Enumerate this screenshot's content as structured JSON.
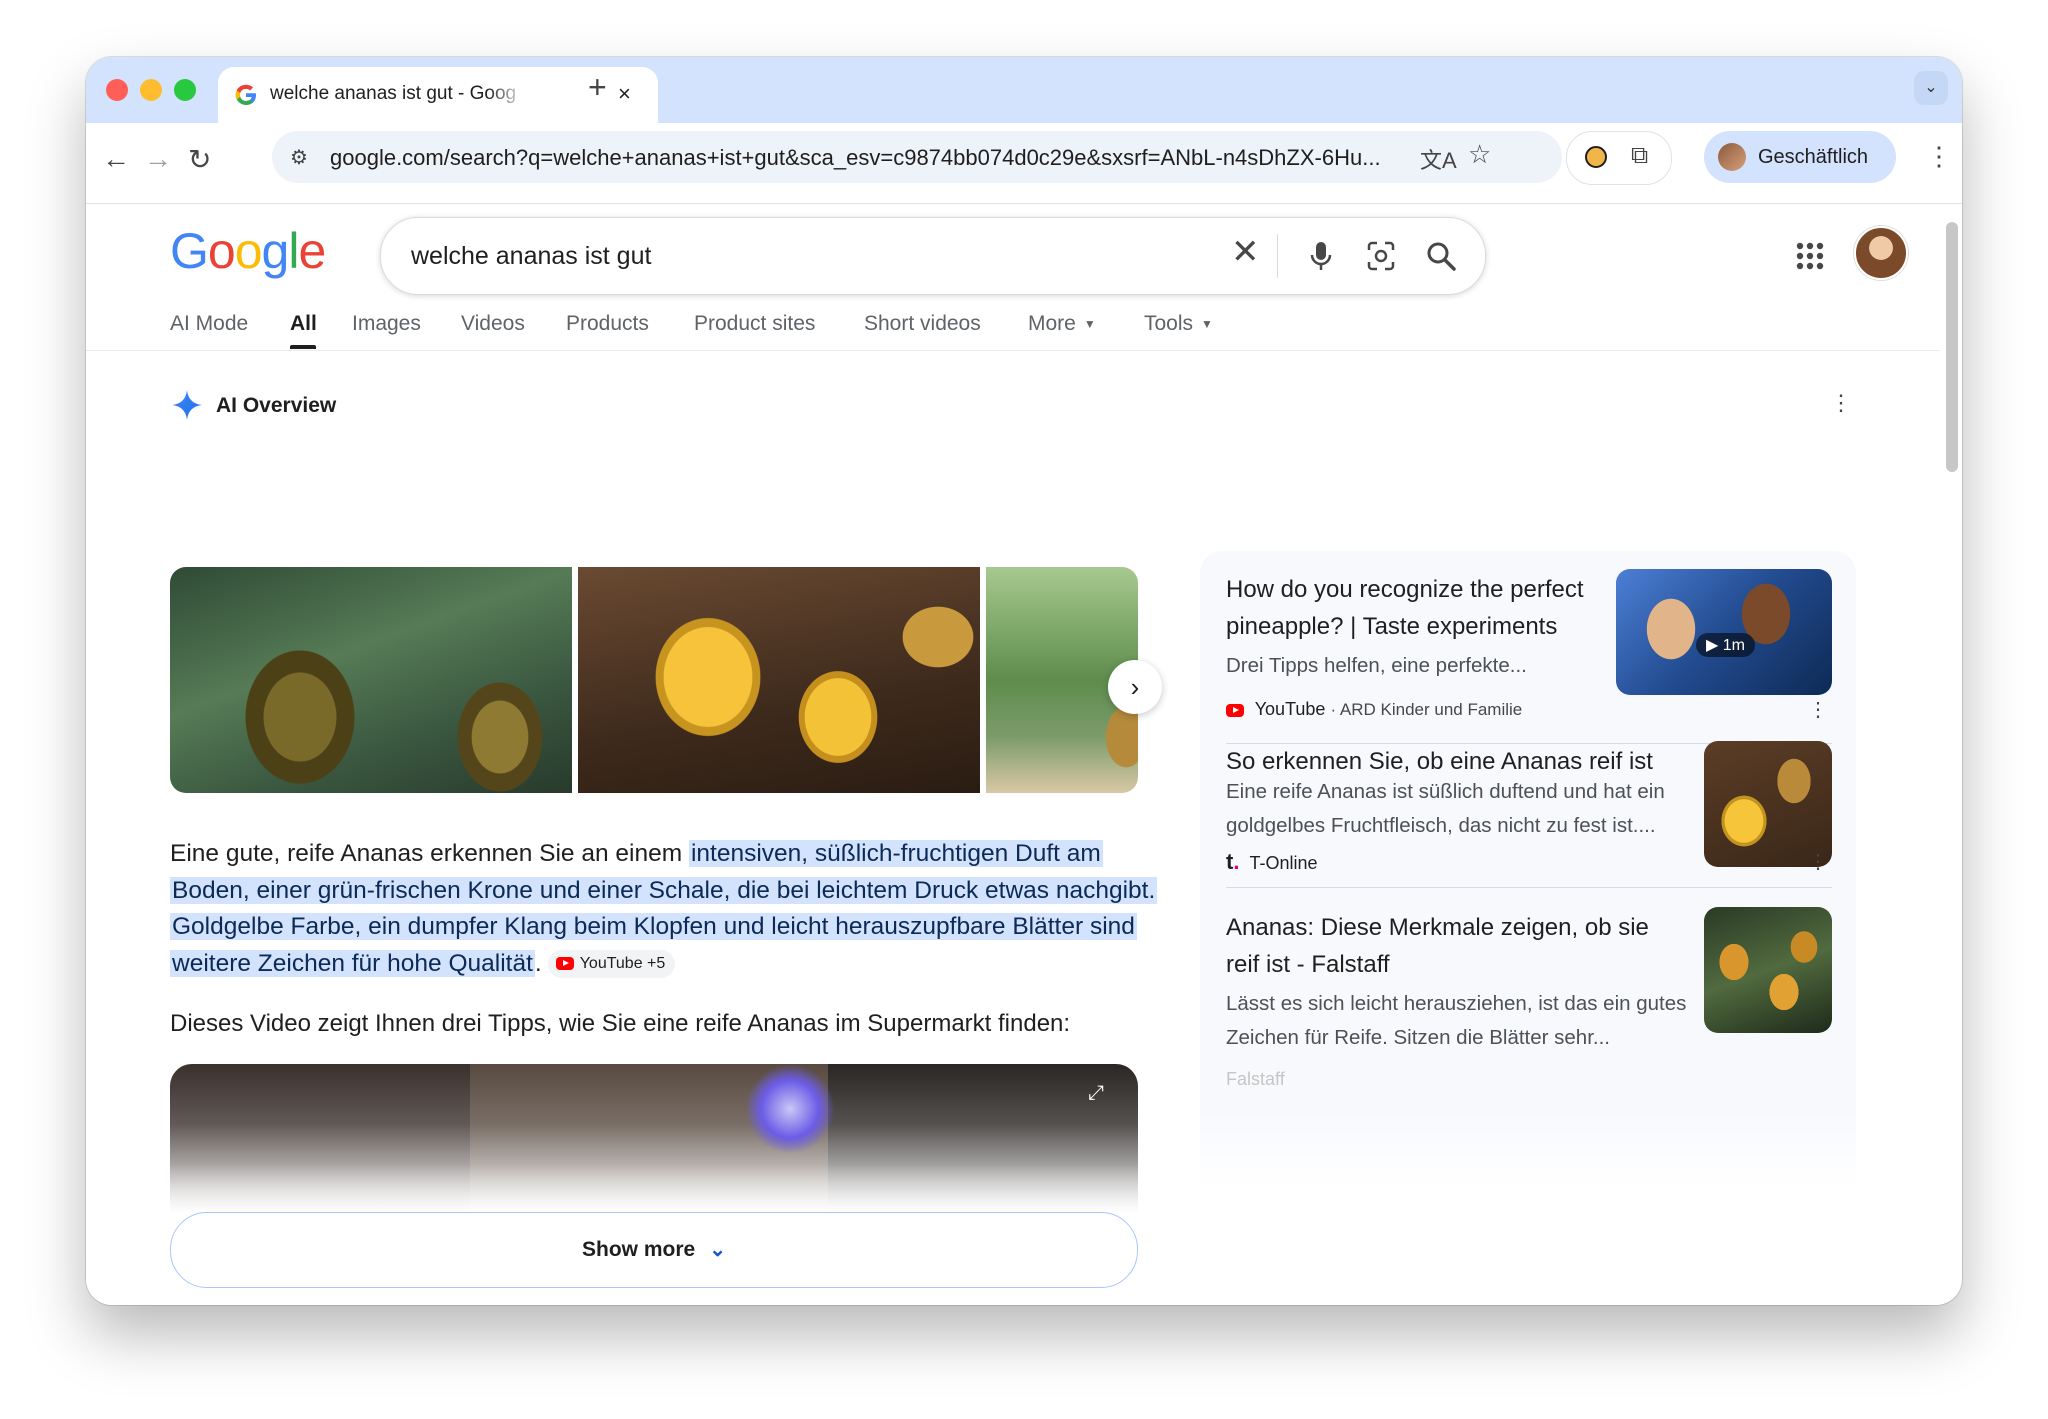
{
  "browser": {
    "tab_title": "welche ananas ist gut - Goog",
    "tab_close": "×",
    "new_tab": "+",
    "url": "google.com/search?q=welche+ananas+ist+gut&sca_esv=c9874bb074d0c29e&sxsrf=ANbL-n4sDhZX-6Hu...",
    "profile_label": "Geschäftlich"
  },
  "google": {
    "logo_letters": [
      "G",
      "o",
      "o",
      "g",
      "l",
      "e"
    ],
    "logo_colors": [
      "#4285f4",
      "#ea4335",
      "#fbbc05",
      "#4285f4",
      "#34a853",
      "#ea4335"
    ],
    "query": "welche ananas ist gut",
    "tabs": [
      {
        "label": "AI Mode"
      },
      {
        "label": "All"
      },
      {
        "label": "Images"
      },
      {
        "label": "Videos"
      },
      {
        "label": "Products"
      },
      {
        "label": "Product sites"
      },
      {
        "label": "Short videos"
      },
      {
        "label": "More"
      },
      {
        "label": "Tools"
      }
    ],
    "active_tab": "All"
  },
  "ai_overview": {
    "heading": "AI Overview",
    "para_plain": "Eine gute, reife Ananas erkennen Sie an einem ",
    "para_highlight": "intensiven, süßlich-fruchtigen Duft am Boden, einer grün-frischen Krone und einer Schale, die bei leichtem Druck etwas nachgibt. Goldgelbe Farbe, ein dumpfer Klang beim Klopfen und leicht herauszupfbare Blätter sind weitere Zeichen für hohe Qualität",
    "para_end": ".",
    "source_chip": "YouTube +5",
    "video_intro": "Dieses Video zeigt Ihnen drei Tipps, wie Sie eine reife Ananas im Supermarkt finden:",
    "show_more": "Show more"
  },
  "sources": [
    {
      "title": "How do you recognize the perfect pineapple? | Taste experiments",
      "description": "Drei Tipps helfen, eine perfekte...",
      "source": "YouTube",
      "channel": "ARD Kinder und Familie",
      "duration": "1m"
    },
    {
      "title": "So erkennen Sie, ob eine Ananas reif ist",
      "description": "Eine reife Ananas ist süßlich duftend und hat ein goldgelbes Fruchtfleisch, das nicht zu fest ist....",
      "source": "T-Online"
    },
    {
      "title": "Ananas: Diese Merkmale zeigen, ob sie reif ist - Falstaff",
      "description": "Lässt es sich leicht herausziehen, ist das ein gutes Zeichen für Reife. Sitzen die Blätter sehr...",
      "source": "Falstaff"
    }
  ],
  "colors": {
    "accent": "#0b57d0",
    "highlight": "#d3e3fd",
    "tab_strip": "#d3e3fd"
  }
}
